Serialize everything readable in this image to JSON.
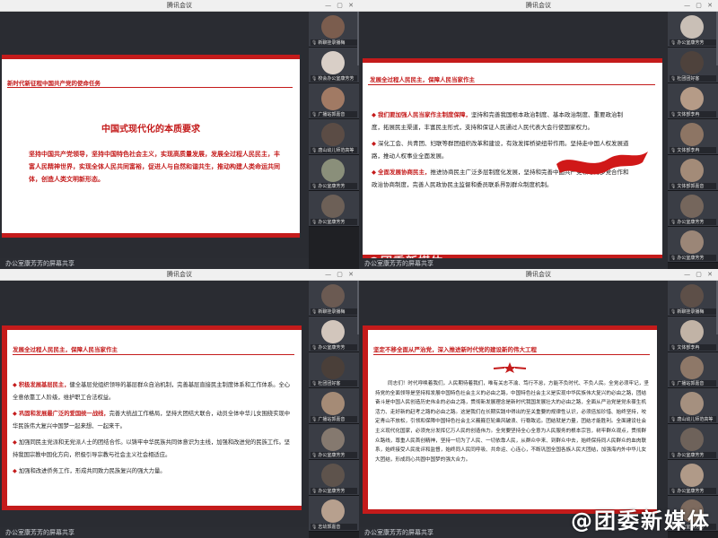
{
  "window_title": "腾讯会议",
  "window_controls": "— ▢ ✕",
  "footer_text": "办公室康芳芳的屏幕共享",
  "watermark": "@团委新媒体",
  "panels": {
    "p1": {
      "heading": "新时代新征程中国共产党的使命任务",
      "center_title": "中国式现代化的本质要求",
      "body": "坚持中国共产党领导，坚持中国特色社会主义，实现高质量发展，发展全过程人民民主，丰富人民精神世界，实现全体人民共同富裕，促进人与自然和谐共生，推动构建人类命运共同体，创造人类文明新形态。",
      "participants": [
        {
          "name": "新聊挂录播梅",
          "face": "#7b5d4e"
        },
        {
          "name": "校会办公室康芳芳",
          "face": "#d9cfc7"
        },
        {
          "name": "广播站郭嘉音",
          "face": "#a17a64"
        },
        {
          "name": "唐山幼儿师范高等",
          "face": "#5b4c45"
        },
        {
          "name": "办公室康芳芳",
          "face": "#8a8f7a"
        },
        {
          "name": "办公室康芳芳",
          "face": "#6d6057"
        }
      ]
    },
    "p2": {
      "heading": "发展全过程人民民主，保障人民当家作主",
      "items": [
        {
          "lead": "我们要加强人民当家作主制度保障，",
          "text": "坚持和完善我国根本政治制度、基本政治制度、重要政治制度，拓展民主渠道，丰富民主形式，支持和保证人民通过人民代表大会行使国家权力。"
        },
        {
          "lead": "",
          "text": "深化工会、共青团、妇联等群团组织改革和建设，有效发挥桥梁纽带作用。坚持走中国人权发展道路，推动人权事业全面发展。"
        },
        {
          "lead": "全面发展协商民主，",
          "text": "推进协商民主广泛多层制度化发展，坚持和完善中国共产党领导的多党合作和政治协商制度，完善人民政协民主监督和委员联系界别群众制度机制。"
        }
      ],
      "participants": [
        {
          "name": "办公室康芳芳",
          "face": "#c9bfb6"
        },
        {
          "name": "杜团团好客",
          "face": "#4e423c"
        },
        {
          "name": "文体部李冉",
          "face": "#b59b87"
        },
        {
          "name": "文体部李冉",
          "face": "#8d7564"
        },
        {
          "name": "文体部郭嘉音",
          "face": "#a38b78"
        },
        {
          "name": "办公室康芳芳",
          "face": "#75665c"
        },
        {
          "name": "办公室康芳芳",
          "face": "#9b8677"
        }
      ]
    },
    "p3": {
      "heading": "发展全过程人民民主，保障人民当家作主",
      "items": [
        {
          "lead": "积极发展基层民主，",
          "text": "健全基层党组织领导的基层群众自治机制，完善基层直接民主制度体系和工作体系。全心全意依靠工人阶级，维护职工合法权益。"
        },
        {
          "lead": "巩固和发展最广泛的爱国统一战线，",
          "text": "完善大统战工作格局，坚持大团结大联合，动员全体中华儿女围绕实现中华民族伟大复兴中国梦一起来想、一起来干。"
        },
        {
          "lead": "",
          "text": "加强同民主党派和无党派人士的团结合作。以铸牢中华民族共同体意识为主线，加强和改进党的民族工作。坚持我国宗教中国化方向，积极引导宗教与社会主义社会相适应。"
        },
        {
          "lead": "",
          "text": "加强和改进侨务工作，形成共同致力民族复兴的强大力量。"
        }
      ],
      "participants": [
        {
          "name": "新聊挂录播梅",
          "face": "#6b5a52"
        },
        {
          "name": "办公室康芳芳",
          "face": "#d2c6bc"
        },
        {
          "name": "杜团团好客",
          "face": "#4a3f39"
        },
        {
          "name": "广播站郭嘉音",
          "face": "#a58b76"
        },
        {
          "name": "办公室康芳芳",
          "face": "#85796f"
        },
        {
          "name": "办公室康芳芳",
          "face": "#5e534c"
        },
        {
          "name": "志幼郭嘉音",
          "face": "#b7a08e"
        }
      ]
    },
    "p4": {
      "heading": "坚定不移全面从严治党，深入推进新时代党的建设新的伟大工程",
      "paragraph": "同志们！时代呼唤着我们，人民期待着我们，唯有关志不渝、笃行不怠，方能不负时代、不负人民。全党必须牢记，坚持党的全面领导是坚持和发展中国特色社会主义的必由之路，中国特色社会主义是实现中华民族伟大复兴的必由之路，团结奋斗是中国人民创造历史伟业的必由之路，贯彻新发展理念是新时代我国发展壮大的必由之路，全面从严治党是党永葆生机活力、走好新的赶考之路的必由之路。这是我们在长期实践中得出的至关重要的规律性认识，必须倍加珍惜、始终坚持，咬定青山不放松，引领和保障中国特色社会主义巍巍巨轮乘风破浪、行稳致远。团结就是力量，团结才能胜利。全面建设社会主义现代化国家，必须充分发挥亿万人民的创造伟力。全党要坚持全心全意为人民服务的根本宗旨，树牢群众观点，贯彻群众路线，尊重人民首创精神，坚持一切为了人民、一切依靠人民，从群众中来、到群众中去，始终保持同人民群众的血肉联系，始终接受人民批评和监督，始终同人民同呼吸、共命运、心连心，不断巩固全国各族人民大团结，加强海内外中华儿女大团结，形成同心共圆中国梦的强大合力。",
      "watermark": "@团委新媒体",
      "participants": [
        {
          "name": "新聊挂录播梅",
          "face": "#5d4f48"
        },
        {
          "name": "文体部李冉",
          "face": "#c1b3a6"
        },
        {
          "name": "广播站郭嘉音",
          "face": "#8e7868"
        },
        {
          "name": "唐山幼儿师范高等",
          "face": "#a5907f"
        },
        {
          "name": "办公室康芳芳",
          "face": "#6e625a"
        },
        {
          "name": "办公室康芳芳",
          "face": "#b09a88"
        },
        {
          "name": "办公室康芳芳",
          "face": "#7d6a5e"
        }
      ]
    }
  }
}
